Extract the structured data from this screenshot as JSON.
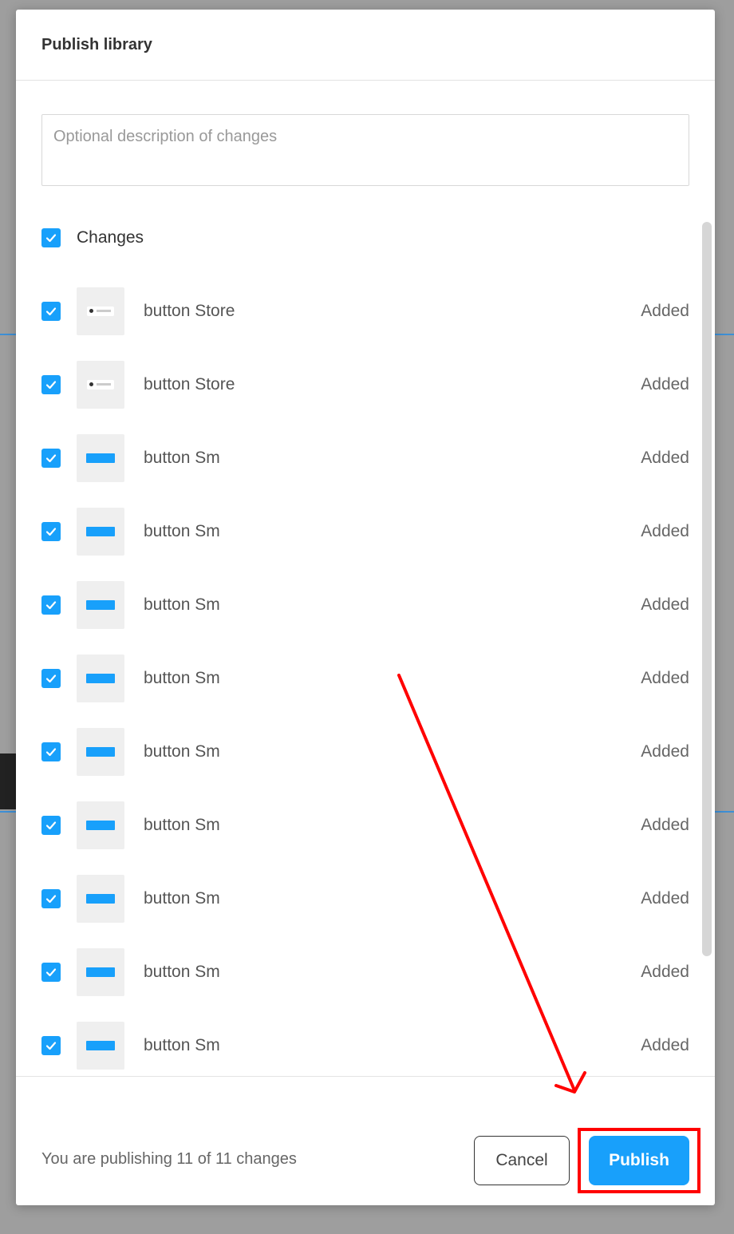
{
  "modal": {
    "title": "Publish library",
    "description_placeholder": "Optional description of changes",
    "changes_label": "Changes",
    "items": [
      {
        "name": "button Store",
        "status": "Added",
        "thumb": "store"
      },
      {
        "name": "button Store",
        "status": "Added",
        "thumb": "store"
      },
      {
        "name": "button Sm",
        "status": "Added",
        "thumb": "blue"
      },
      {
        "name": "button Sm",
        "status": "Added",
        "thumb": "blue"
      },
      {
        "name": "button Sm",
        "status": "Added",
        "thumb": "blue"
      },
      {
        "name": "button Sm",
        "status": "Added",
        "thumb": "blue"
      },
      {
        "name": "button Sm",
        "status": "Added",
        "thumb": "blue"
      },
      {
        "name": "button Sm",
        "status": "Added",
        "thumb": "blue"
      },
      {
        "name": "button Sm",
        "status": "Added",
        "thumb": "blue"
      },
      {
        "name": "button Sm",
        "status": "Added",
        "thumb": "blue"
      },
      {
        "name": "button Sm",
        "status": "Added",
        "thumb": "blue"
      }
    ],
    "footer_text": "You are publishing 11 of 11 changes",
    "cancel_label": "Cancel",
    "publish_label": "Publish"
  },
  "colors": {
    "accent": "#18a0fb",
    "annotation": "#ff0000"
  },
  "icons": {
    "checkbox": "checkmark-icon"
  }
}
